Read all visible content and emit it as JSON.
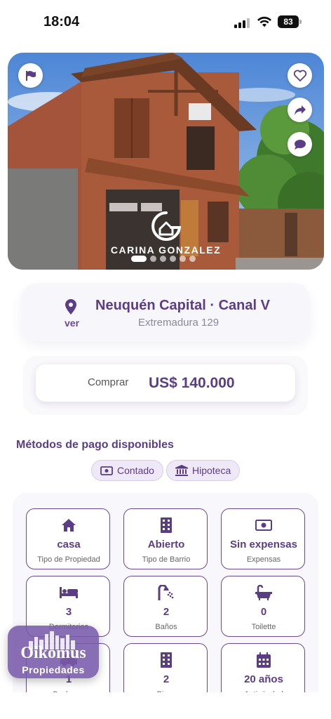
{
  "status_bar": {
    "time": "18:04",
    "battery": "83"
  },
  "hero": {
    "watermark": "CARINA GONZALEZ",
    "slide_count": 6,
    "active_slide": 1,
    "buttons": [
      "flag-icon",
      "heart-icon",
      "share-icon",
      "chat-icon"
    ]
  },
  "location": {
    "title": "Neuquén Capital · Canal V",
    "address": "Extremadura 129",
    "map_link": "ver"
  },
  "price": {
    "operation": "Comprar",
    "value": "US$ 140.000"
  },
  "payment": {
    "title": "Métodos de pago disponibles",
    "methods": [
      {
        "label": "Contado",
        "icon": "money-icon"
      },
      {
        "label": "Hipoteca",
        "icon": "bank-icon"
      }
    ]
  },
  "features": [
    {
      "value": "casa",
      "label": "Tipo de Propiedad",
      "icon": "home-icon"
    },
    {
      "value": "Abierto",
      "label": "Tipo de Barrio",
      "icon": "building-icon"
    },
    {
      "value": "Sin expensas",
      "label": "Expensas",
      "icon": "money-icon"
    },
    {
      "value": "3",
      "label": "Dormitorios",
      "icon": "bed-icon"
    },
    {
      "value": "2",
      "label": "Baños",
      "icon": "shower-icon"
    },
    {
      "value": "0",
      "label": "Toilette",
      "icon": "bath-icon"
    },
    {
      "value": "1",
      "label": "Cocheras",
      "icon": "car-icon"
    },
    {
      "value": "2",
      "label": "Pisos",
      "icon": "building-icon"
    },
    {
      "value": "20 años",
      "label": "Antigüedad",
      "icon": "calendar-icon"
    }
  ],
  "brand": {
    "name": "Oikomus",
    "subtitle": "Propiedades"
  },
  "colors": {
    "accent": "#5b3d86",
    "chip_bg": "#efe9f7",
    "card_bg": "#f7f6fa"
  }
}
